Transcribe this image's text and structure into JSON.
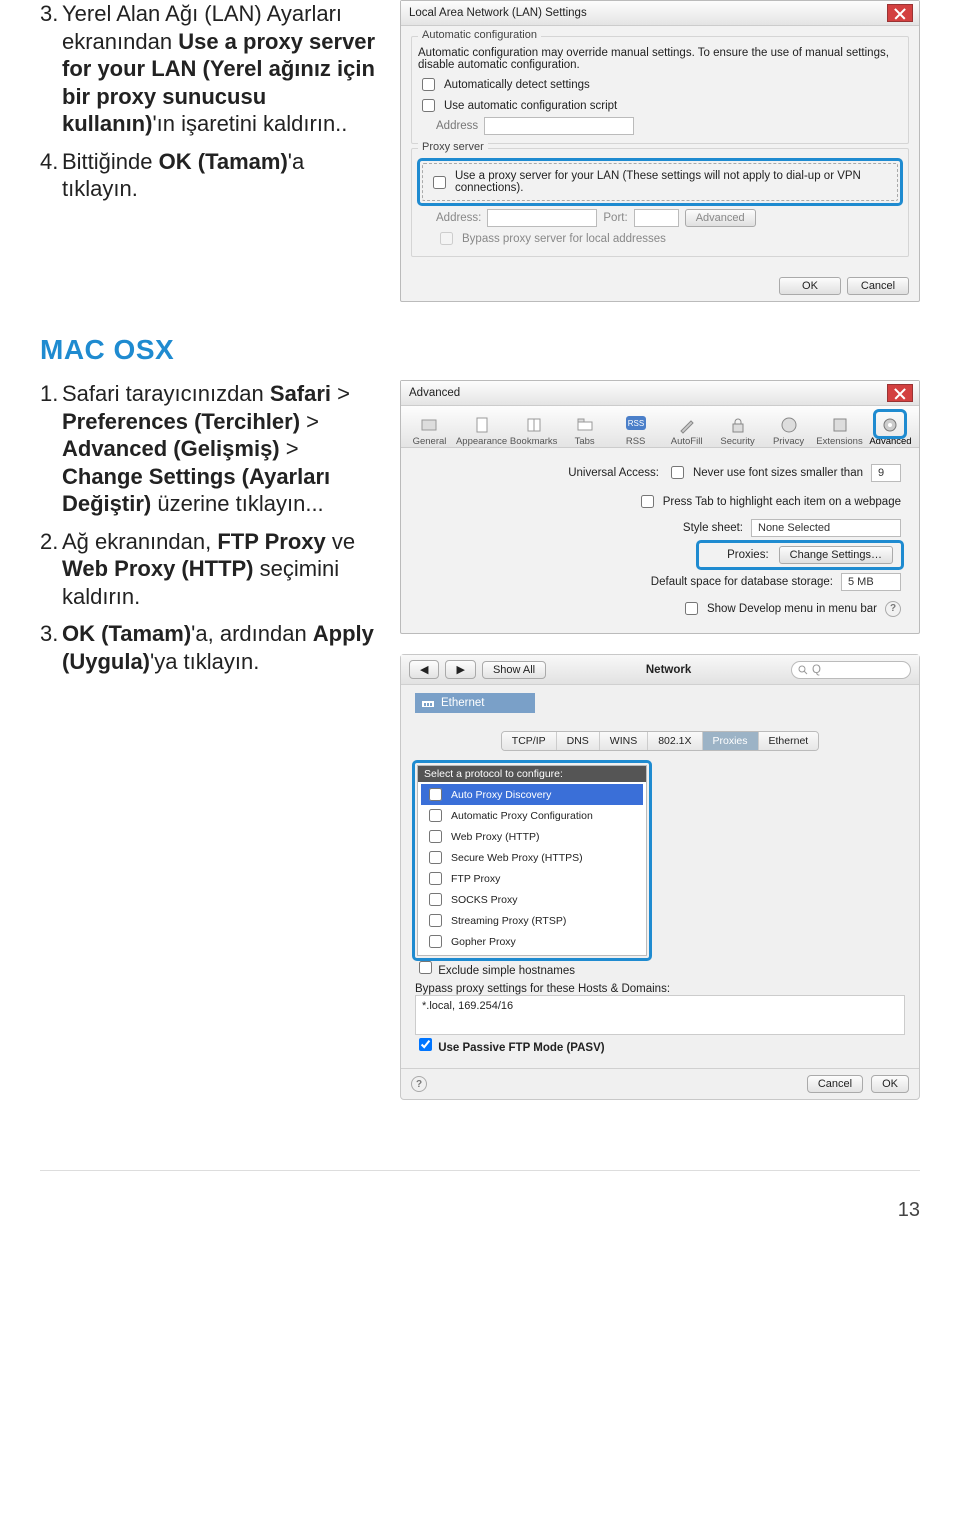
{
  "page_number": "13",
  "instructions_top": {
    "item3_num": "3.",
    "item3_prefix": "Yerel Alan Ağı (LAN) Ayarları ekranından ",
    "item3_bold": "Use a proxy server for your LAN (Yerel ağınız için bir proxy sunucusu kullanın)",
    "item3_suffix": "'ın işaretini kaldırın..",
    "item4_num": "4.",
    "item4_prefix": "Bittiğinde ",
    "item4_bold": "OK (Tamam)",
    "item4_suffix": "'a tıklayın."
  },
  "mac_heading": "MAC OSX",
  "instructions_mac": {
    "i1_num": "1.",
    "i1_prefix": "Safari tarayıcınızdan ",
    "i1_b1": "Safari",
    "i1_s1": " > ",
    "i1_b2": "Preferences (Tercihler)",
    "i1_s2": " > ",
    "i1_b3": "Advanced (Gelişmiş)",
    "i1_s3": " > ",
    "i1_b4": "Change Settings (Ayarları Değiştir)",
    "i1_suffix": " üzerine tıklayın...",
    "i2_num": "2.",
    "i2_prefix": "Ağ ekranından, ",
    "i2_b1": "FTP Proxy",
    "i2_mid": " ve ",
    "i2_b2": "Web Proxy (HTTP)",
    "i2_suffix": " seçimini kaldırın.",
    "i3_num": "3.",
    "i3_b1": "OK (Tamam)",
    "i3_mid": "'a, ardından ",
    "i3_b2": "Apply (Uygula)",
    "i3_suffix": "'ya tıklayın."
  },
  "lan_dialog": {
    "title": "Local Area Network (LAN) Settings",
    "auto_legend": "Automatic configuration",
    "auto_note": "Automatic configuration may override manual settings. To ensure the use of manual settings, disable automatic configuration.",
    "auto_detect": "Automatically detect settings",
    "auto_script": "Use automatic configuration script",
    "address": "Address",
    "proxy_legend": "Proxy server",
    "proxy_use": "Use a proxy server for your LAN (These settings will not apply to dial-up or VPN connections).",
    "addr2": "Address:",
    "port": "Port:",
    "adv": "Advanced",
    "bypass": "Bypass proxy server for local addresses",
    "ok": "OK",
    "cancel": "Cancel"
  },
  "safari_prefs": {
    "title": "Advanced",
    "tabs": [
      "General",
      "Appearance",
      "Bookmarks",
      "Tabs",
      "RSS",
      "AutoFill",
      "Security",
      "Privacy",
      "Extensions",
      "Advanced"
    ],
    "univ_access": "Universal Access:",
    "never_fonts": "Never use font sizes smaller than",
    "font_size": "9",
    "press_tab": "Press Tab to highlight each item on a webpage",
    "stylesheet_lbl": "Style sheet:",
    "stylesheet_val": "None Selected",
    "proxies_lbl": "Proxies:",
    "change_btn": "Change Settings…",
    "db_lbl": "Default space for database storage:",
    "db_val": "5 MB",
    "show_dev": "Show Develop menu in menu bar"
  },
  "network": {
    "title": "Network",
    "show_all": "Show All",
    "search_placeholder": "Q",
    "eth": "Ethernet",
    "tabs": [
      "TCP/IP",
      "DNS",
      "WINS",
      "802.1X",
      "Proxies",
      "Ethernet"
    ],
    "proto_head": "Select a protocol to configure:",
    "protocols": [
      "Auto Proxy Discovery",
      "Automatic Proxy Configuration",
      "Web Proxy (HTTP)",
      "Secure Web Proxy (HTTPS)",
      "FTP Proxy",
      "SOCKS Proxy",
      "Streaming Proxy (RTSP)",
      "Gopher Proxy"
    ],
    "exclude": "Exclude simple hostnames",
    "bypass_lbl": "Bypass proxy settings for these Hosts & Domains:",
    "bypass_val": "*.local, 169.254/16",
    "pasv": "Use Passive FTP Mode (PASV)",
    "cancel": "Cancel",
    "ok": "OK"
  }
}
